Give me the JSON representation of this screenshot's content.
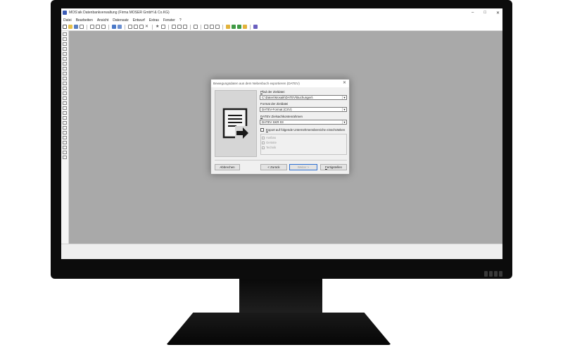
{
  "window": {
    "title": "MOS'aik Datenbankverwaltung (Firma MOSER GmbH & Co.KG)",
    "controls": [
      "–",
      "□",
      "✕"
    ]
  },
  "menubar": {
    "items": [
      "Datei",
      "Bearbeiten",
      "Ansicht",
      "Datensatz",
      "Entwurf",
      "Extras",
      "Fenster",
      "?"
    ]
  },
  "dialog": {
    "title": "Bewegungsdaten aus dem Nebenbuch exportieren (DATEV)",
    "close": "✕",
    "target_file_label_prefix": "P",
    "target_file_label_rest": "fad der Zieldatei",
    "target_file_value": "C:\\Daten\\Mosaik\\DATEV\\Buchungen\\",
    "format_label": "Format der Zieldatei",
    "format_value": "DATEV-Format (CSV)",
    "chart_label_prefix": "D",
    "chart_label_rest": "ATEV Zielsachkontenrahmen",
    "chart_value": "DATEV SKR 03",
    "restrict_label_prefix": "E",
    "restrict_label_rest": "xport auf folgende Unternehmensbereiche einschränken",
    "departments": [
      "Ausbau",
      "Gerüste",
      "Technik"
    ],
    "buttons": {
      "cancel": "Abbrechen",
      "back": "< Zurück",
      "next": "Weiter >",
      "finish_prefix": "F",
      "finish_rest": "ertigstellen"
    }
  },
  "colors": {
    "workspace": "#a9a9a9",
    "monitor": "#0c0c0c",
    "dialog_bg": "#f0f0f0"
  }
}
